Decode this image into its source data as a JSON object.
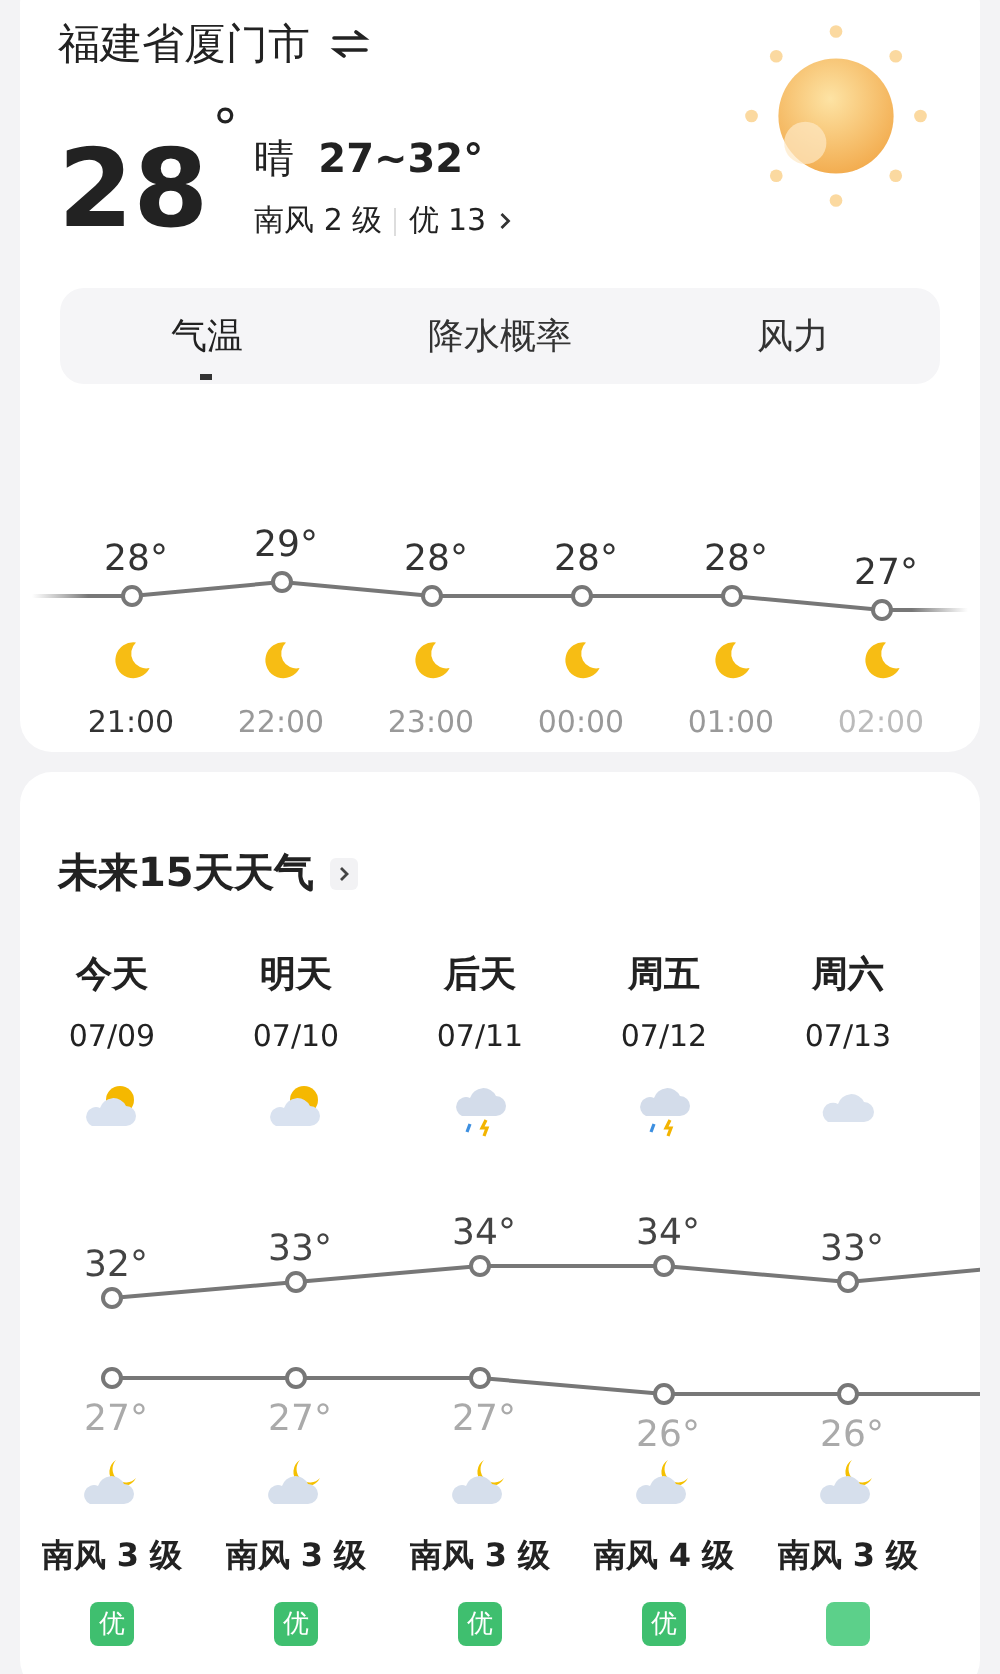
{
  "location": {
    "title": "福建省厦门市"
  },
  "current": {
    "temperature": "28",
    "degree": "°",
    "condition": "晴",
    "range": "27~32°",
    "wind": "南风 2 级",
    "aqi": "优 13"
  },
  "tabs": [
    {
      "label": "气温",
      "selected": true
    },
    {
      "label": "降水概率",
      "selected": false
    },
    {
      "label": "风力",
      "selected": false
    }
  ],
  "hourly": [
    {
      "temp": "28°",
      "time": "21:00",
      "current": true
    },
    {
      "temp": "29°",
      "time": "22:00",
      "current": false
    },
    {
      "temp": "28°",
      "time": "23:00",
      "current": false
    },
    {
      "temp": "28°",
      "time": "00:00",
      "current": false
    },
    {
      "temp": "28°",
      "time": "01:00",
      "current": false
    },
    {
      "temp": "27°",
      "time": "02:00",
      "current": false
    }
  ],
  "forecast": {
    "title": "未来15天天气",
    "days": [
      {
        "name": "今天",
        "date": "07/09",
        "kind": "partly-sunny",
        "high": "32°",
        "low": "27°",
        "wind": "南风 3 级",
        "aqi": "优"
      },
      {
        "name": "明天",
        "date": "07/10",
        "kind": "partly-sunny",
        "high": "33°",
        "low": "27°",
        "wind": "南风 3 级",
        "aqi": "优"
      },
      {
        "name": "后天",
        "date": "07/11",
        "kind": "thunderstorm",
        "high": "34°",
        "low": "27°",
        "wind": "南风 3 级",
        "aqi": "优"
      },
      {
        "name": "周五",
        "date": "07/12",
        "kind": "thunderstorm",
        "high": "34°",
        "low": "26°",
        "wind": "南风 4 级",
        "aqi": "优"
      },
      {
        "name": "周六",
        "date": "07/13",
        "kind": "cloudy",
        "high": "33°",
        "low": "26°",
        "wind": "南风 3 级"
      }
    ]
  }
}
